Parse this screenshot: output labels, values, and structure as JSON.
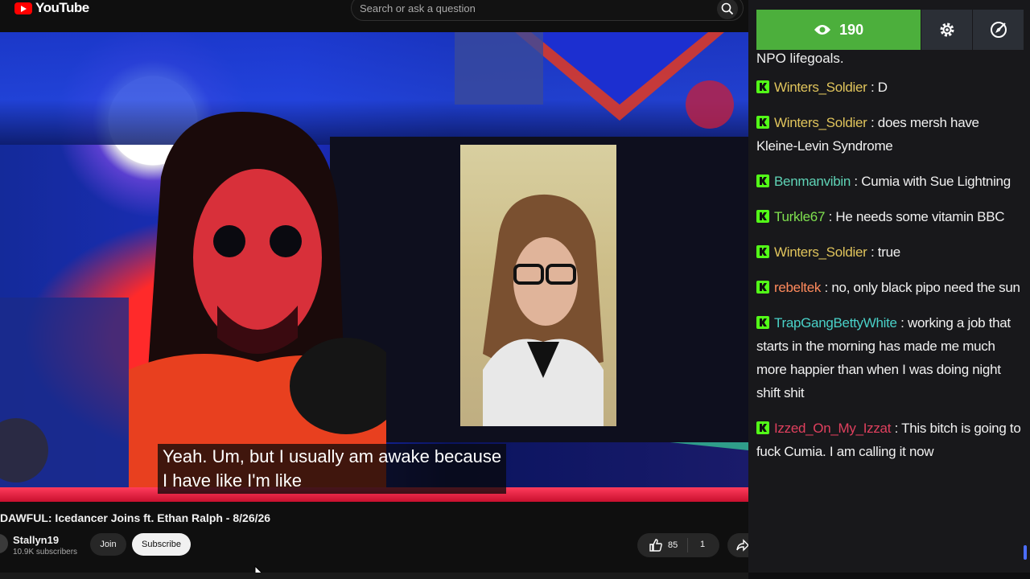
{
  "youtube": {
    "logo_text": "YouTube",
    "search": {
      "placeholder": "Search or ask a question"
    },
    "captions": {
      "line1": "Yeah. Um, but I usually am awake because",
      "line2": "I have like I'm like"
    },
    "video_title": "DAWFUL: Icedancer Joins ft. Ethan Ralph - 8/26/26",
    "channel": {
      "name": "Stallyn19",
      "subscribers": "10.9K subscribers"
    },
    "join_label": "Join",
    "subscribe_label": "Subscribe",
    "like_count": "85",
    "dislike_count": "1"
  },
  "chat": {
    "viewer_count": "190",
    "accent": "#4caf3c",
    "badge_color": "#53fc18",
    "cutoff_text": "NPO lifegoals.",
    "messages": [
      {
        "user": "Winters_Soldier",
        "color": "#e0c45c",
        "text": "D"
      },
      {
        "user": "Winters_Soldier",
        "color": "#e0c45c",
        "text": "does mersh have Kleine-Levin Syndrome"
      },
      {
        "user": "Benmanvibin",
        "color": "#5fd3b6",
        "text": "Cumia with Sue Lightning"
      },
      {
        "user": "Turkle67",
        "color": "#7fe04f",
        "text": "He needs some vitamin BBC"
      },
      {
        "user": "Winters_Soldier",
        "color": "#e0c45c",
        "text": "true"
      },
      {
        "user": "rebeltek",
        "color": "#ff8a5c",
        "text": "no, only black pipo need the sun"
      },
      {
        "user": "TrapGangBettyWhite",
        "color": "#49d1c8",
        "text": "working a job that starts in the morning has made me much more happier than when I was doing night shift shit"
      },
      {
        "user": "Izzed_On_My_Izzat",
        "color": "#e0405e",
        "text": "This bitch is going to fuck Cumia. I am calling it now"
      }
    ]
  }
}
